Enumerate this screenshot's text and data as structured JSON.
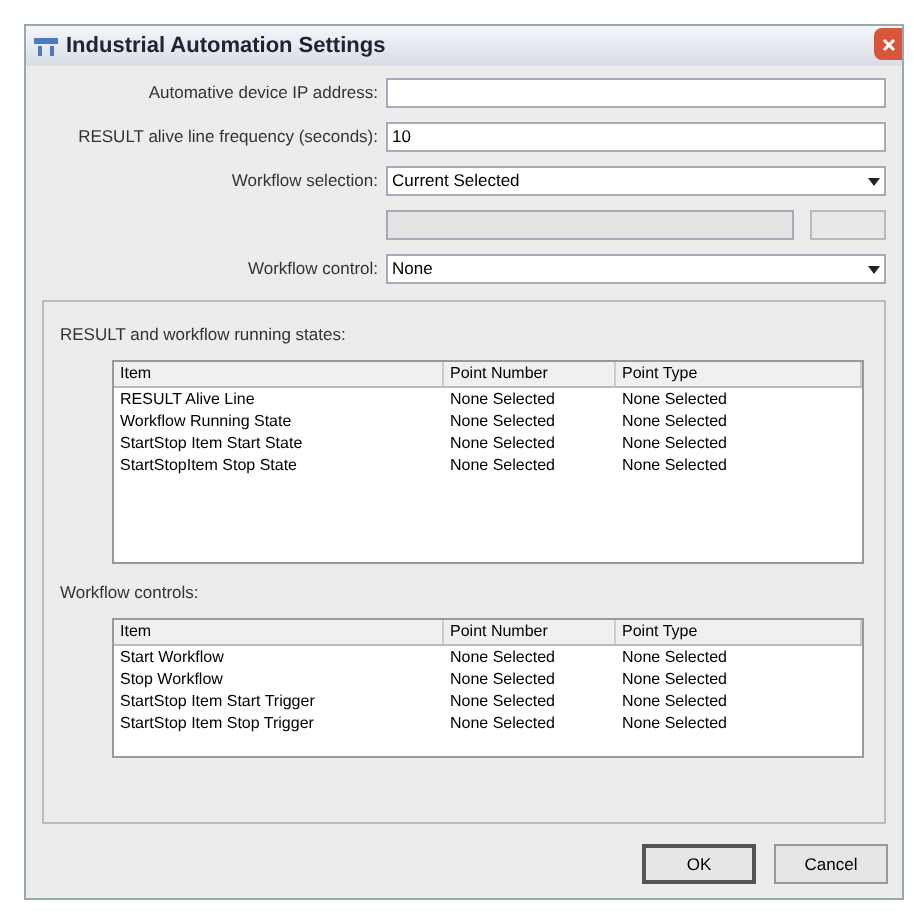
{
  "window": {
    "title": "Industrial Automation Settings"
  },
  "fields": [
    {
      "kind": "text",
      "label": "Automative device IP address:",
      "disabled": false
    },
    {
      "kind": "text",
      "label": "RESULT alive line frequency (seconds):",
      "value": "10",
      "disabled": false
    },
    {
      "kind": "dropdown",
      "label": "Workflow selection:",
      "value": "Current Selected",
      "disabled": false
    },
    {
      "kind": "browse",
      "disabled": true
    },
    {
      "kind": "dropdown",
      "label": "Workflow control:",
      "value": "None",
      "disabled": false
    }
  ],
  "tables": [
    {
      "caption": "RESULT and workflow running states:",
      "columns": [
        "Item",
        "Point Number",
        "Point Type"
      ],
      "rows": [
        [
          "RESULT Alive Line",
          "None Selected",
          "None Selected"
        ],
        [
          "Workflow Running State",
          "None Selected",
          "None Selected"
        ],
        [
          "StartStop Item Start State",
          "None Selected",
          "None Selected"
        ],
        [
          "StartStopItem Stop State",
          "None Selected",
          "None Selected"
        ]
      ]
    },
    {
      "caption": "Workflow controls:",
      "columns": [
        "Item",
        "Point Number",
        "Point Type"
      ],
      "rows": [
        [
          "Start Workflow",
          "None Selected",
          "None Selected"
        ],
        [
          "Stop Workflow",
          "None Selected",
          "None Selected"
        ],
        [
          "StartStop Item Start Trigger",
          "None Selected",
          "None Selected"
        ],
        [
          "StartStop Item Stop Trigger",
          "None Selected",
          "None Selected"
        ]
      ]
    }
  ],
  "buttons": [
    "OK",
    "Cancel"
  ]
}
